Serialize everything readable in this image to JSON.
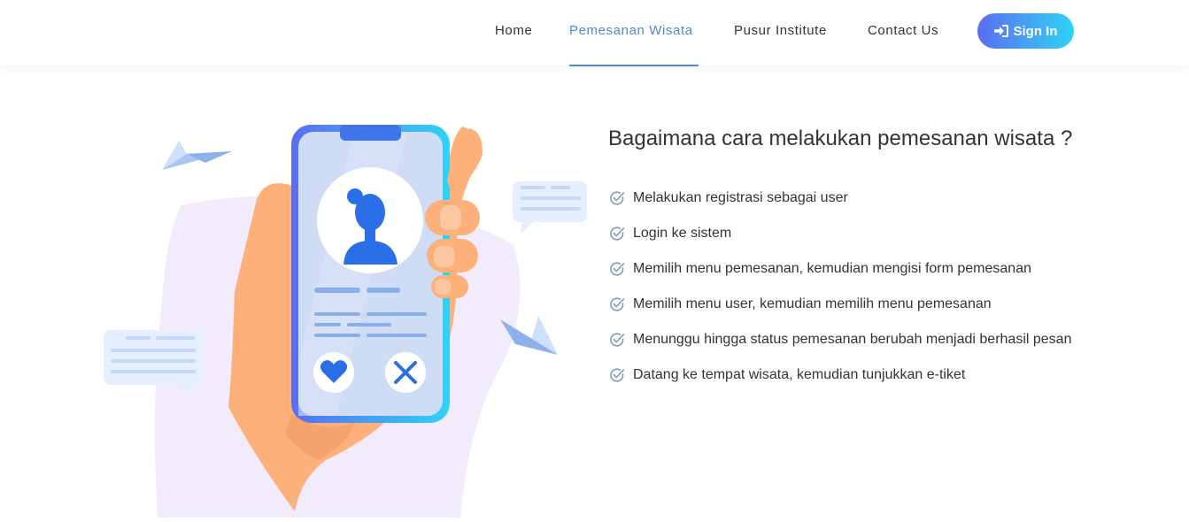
{
  "nav": {
    "items": [
      {
        "label": "Home",
        "active": false
      },
      {
        "label": "Pemesanan Wisata",
        "active": true
      },
      {
        "label": "Pusur Institute",
        "active": false
      },
      {
        "label": "Contact Us",
        "active": false
      }
    ],
    "sign_in_label": "Sign In",
    "sign_in_icon": "sign-in-icon",
    "accent_color": "#4c8bd7",
    "button_gradient": [
      "#5b6df2",
      "#2fd3f6"
    ]
  },
  "main": {
    "title": "Bagaimana cara melakukan pemesanan wisata ?",
    "step_icon": "check-circle-icon",
    "steps": [
      "Melakukan registrasi sebagai user",
      "Login ke sistem",
      "Memilih menu pemesanan, kemudian mengisi form pemesanan",
      "Memilih menu user, kemudian memilih menu pemesanan",
      "Menunggu hingga status pemesanan berubah menjadi berhasil pesan",
      "Datang ke tempat wisata, kemudian tunjukkan e-tiket"
    ]
  },
  "colors": {
    "text": "#333333",
    "check": "#7e9bb8",
    "phone_frame": [
      "#5b6df2",
      "#2fd3f6"
    ],
    "hand": "#fdb07a",
    "blob": "#f1ebfb"
  }
}
